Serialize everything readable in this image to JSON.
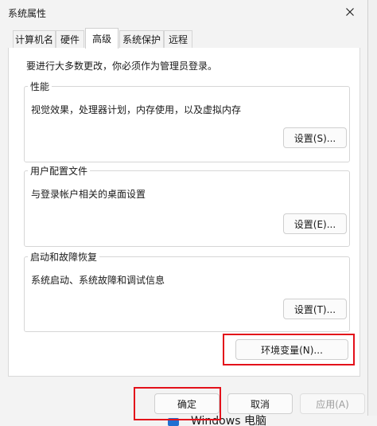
{
  "window": {
    "title": "系统属性"
  },
  "tabs": [
    {
      "label": "计算机名"
    },
    {
      "label": "硬件"
    },
    {
      "label": "高级"
    },
    {
      "label": "系统保护"
    },
    {
      "label": "远程"
    }
  ],
  "admin_note": "要进行大多数更改，你必须作为管理员登录。",
  "performance": {
    "title": "性能",
    "description": "视觉效果，处理器计划，内存使用，以及虚拟内存",
    "button": "设置(S)..."
  },
  "user_profiles": {
    "title": "用户配置文件",
    "description": "与登录帐户相关的桌面设置",
    "button": "设置(E)..."
  },
  "startup_recovery": {
    "title": "启动和故障恢复",
    "description": "系统启动、系统故障和调试信息",
    "button": "设置(T)..."
  },
  "env_vars_button": "环境变量(N)...",
  "footer": {
    "ok": "确定",
    "cancel": "取消",
    "apply": "应用(A)"
  },
  "background_peek": {
    "text": "Windows 电脑"
  },
  "colors": {
    "highlight": "#e3101a",
    "window_bg": "#f3f3f3",
    "panel_bg": "#ffffff"
  }
}
